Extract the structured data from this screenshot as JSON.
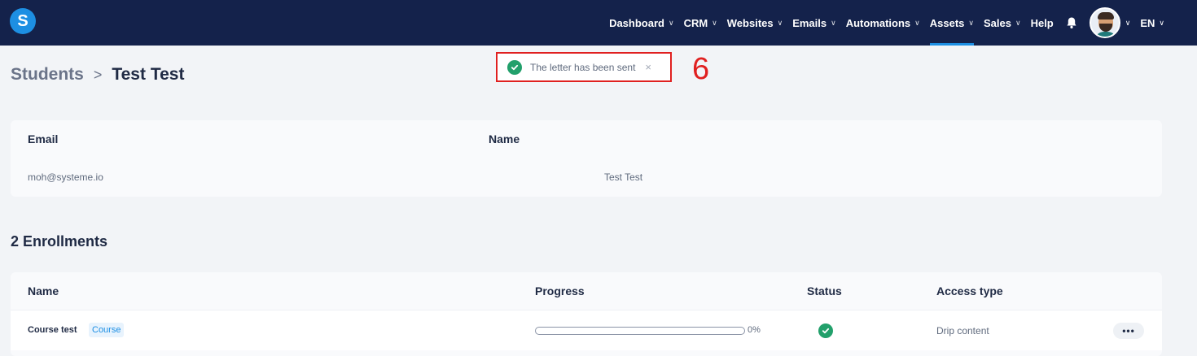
{
  "nav": {
    "logo_text": "S",
    "items": [
      {
        "label": "Dashboard",
        "active": false
      },
      {
        "label": "CRM",
        "active": false
      },
      {
        "label": "Websites",
        "active": false
      },
      {
        "label": "Emails",
        "active": false
      },
      {
        "label": "Automations",
        "active": false
      },
      {
        "label": "Assets",
        "active": true
      },
      {
        "label": "Sales",
        "active": false
      }
    ],
    "help_label": "Help",
    "language": "EN",
    "icons": {
      "notifications": "bell-icon",
      "dropdown": "chevron-down-icon"
    }
  },
  "breadcrumb": {
    "parent": "Students",
    "separator": ">",
    "current": "Test Test"
  },
  "toast": {
    "message": "The letter has been sent",
    "close": "×",
    "icon": "check-circle-icon"
  },
  "annotation": {
    "label": "6"
  },
  "student": {
    "columns": {
      "email": "Email",
      "name": "Name"
    },
    "email": "moh@systeme.io",
    "name": "Test Test"
  },
  "enrollments": {
    "title": "2 Enrollments",
    "columns": {
      "name": "Name",
      "progress": "Progress",
      "status": "Status",
      "access_type": "Access type"
    },
    "rows": [
      {
        "name": "Course test",
        "badge": "Course",
        "progress_percent": 0,
        "progress_label": "0%",
        "status": "check-circle-icon",
        "access_type": "Drip content",
        "actions": "•••"
      }
    ]
  },
  "colors": {
    "navbar": "#14224b",
    "accent": "#1d8fe3",
    "success": "#22a06b",
    "annotation": "#e02020"
  }
}
